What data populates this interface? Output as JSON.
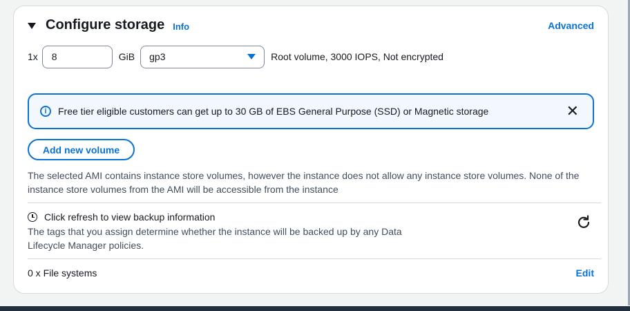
{
  "header": {
    "title": "Configure storage",
    "info_label": "Info",
    "advanced_label": "Advanced"
  },
  "volume": {
    "quantity_prefix": "1x",
    "size_value": "8",
    "size_unit": "GiB",
    "type_selected": "gp3",
    "description": "Root volume,  3000 IOPS,  Not encrypted"
  },
  "alert": {
    "text": "Free tier eligible customers can get up to 30 GB of EBS General Purpose (SSD) or Magnetic storage",
    "info_glyph": "i",
    "close_glyph": "✕"
  },
  "add_volume_label": "Add new volume",
  "ami_note": "The selected AMI contains instance store volumes, however the instance does not allow any instance store volumes. None of the instance store volumes from the AMI will be accessible from the instance",
  "backup": {
    "title": "Click refresh to view backup information",
    "description": "The tags that you assign determine whether the instance will be backed up by any Data Lifecycle Manager policies."
  },
  "file_systems": {
    "label": "0 x File systems",
    "edit_label": "Edit"
  },
  "colors": {
    "accent": "#0972d3",
    "text": "#16191f",
    "secondary_text": "#414d5c",
    "alert_bg": "#f2f8fd",
    "border": "#d5dbdb"
  },
  "icons": {
    "collapse": "caret-down-icon",
    "select": "dropdown-caret-icon",
    "alert": "info-circle-icon",
    "close": "close-icon",
    "backup": "clock-icon",
    "refresh": "refresh-icon"
  }
}
